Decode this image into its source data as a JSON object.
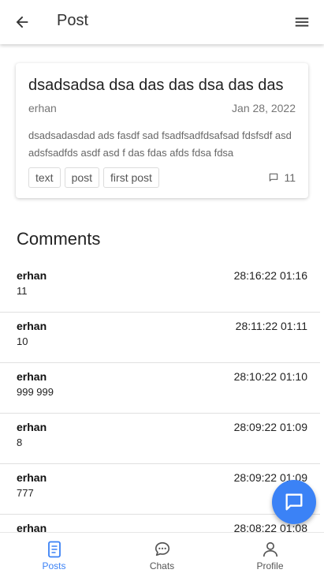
{
  "appbar": {
    "title": "Post"
  },
  "post": {
    "title": "dsadsadsa dsa das das dsa das das",
    "author": "erhan",
    "date": "Jan 28, 2022",
    "body": "dsadsadasdad ads fasdf sad fsadfsadfdsafsad fdsfsdf asd adsfsadfds asdf asd f das fdas afds fdsa fdsa",
    "tags": [
      "text",
      "post",
      "first post"
    ],
    "comment_count": "11"
  },
  "comments_heading": "Comments",
  "comments": [
    {
      "author": "erhan",
      "time": "28:16:22 01:16",
      "text": "11"
    },
    {
      "author": "erhan",
      "time": "28:11:22 01:11",
      "text": "10"
    },
    {
      "author": "erhan",
      "time": "28:10:22 01:10",
      "text": "999 999"
    },
    {
      "author": "erhan",
      "time": "28:09:22 01:09",
      "text": "8"
    },
    {
      "author": "erhan",
      "time": "28:09:22 01:09",
      "text": "777"
    },
    {
      "author": "erhan",
      "time": "28:08:22 01:08",
      "text": ""
    }
  ],
  "nav": {
    "items": [
      {
        "label": "Posts",
        "icon": "document-icon",
        "active": true
      },
      {
        "label": "Chats",
        "icon": "chat-bubble-icon",
        "active": false
      },
      {
        "label": "Profile",
        "icon": "person-icon",
        "active": false
      }
    ]
  },
  "colors": {
    "accent": "#3b82f6",
    "divider": "#e0e0e0",
    "muted": "#757575"
  }
}
